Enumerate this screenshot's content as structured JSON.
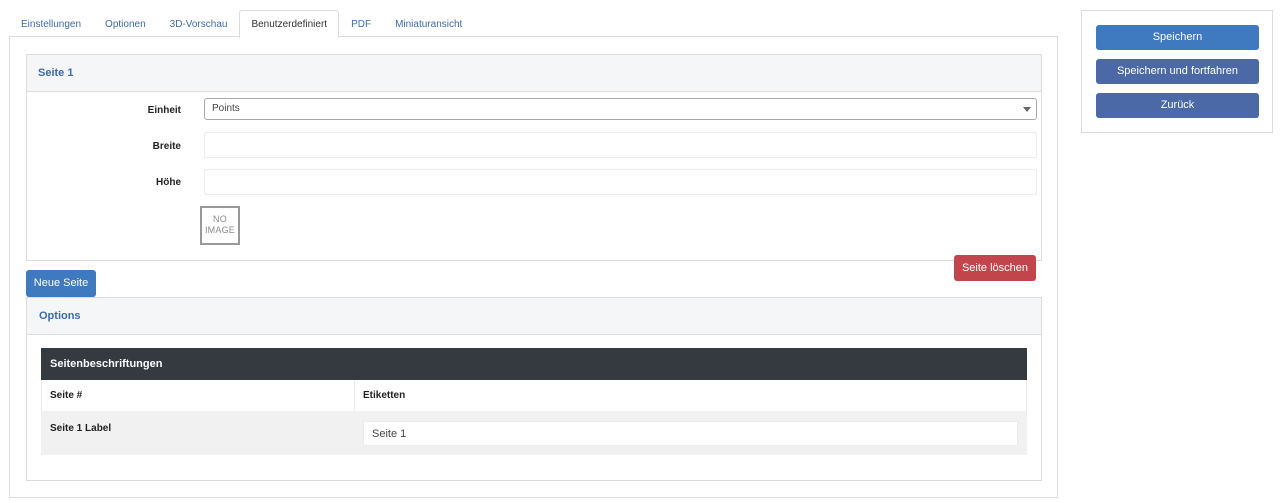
{
  "tabs": [
    {
      "label": "Einstellungen"
    },
    {
      "label": "Optionen"
    },
    {
      "label": "3D-Vorschau"
    },
    {
      "label": "Benutzerdefiniert"
    },
    {
      "label": "PDF"
    },
    {
      "label": "Miniaturansicht"
    }
  ],
  "active_tab": "Benutzerdefiniert",
  "page_panel": {
    "title": "Seite 1",
    "unit_label": "Einheit",
    "unit_value": "Points",
    "width_label": "Breite",
    "width_value": "",
    "height_label": "Höhe",
    "height_value": "",
    "no_image_line1": "NO",
    "no_image_line2": "IMAGE",
    "delete_button": "Seite löschen"
  },
  "new_page_button": "Neue Seite",
  "options_panel": {
    "title": "Options",
    "table_title": "Seitenbeschriftungen",
    "col_page": "Seite #",
    "col_labels": "Etiketten",
    "rows": [
      {
        "page": "Seite 1 Label",
        "label": "Seite 1"
      }
    ]
  },
  "sidebar": {
    "save": "Speichern",
    "save_continue": "Speichern und fortfahren",
    "back": "Zurück"
  },
  "colors": {
    "primary": "#3f79bf",
    "secondary": "#4a69a6",
    "danger": "#c2454b",
    "table_header": "#343a40",
    "link": "#3c6bad"
  }
}
